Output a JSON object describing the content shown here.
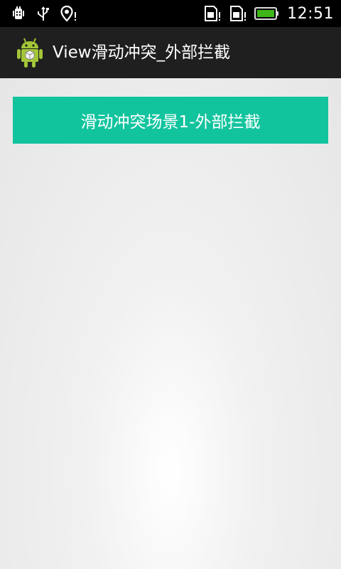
{
  "status_bar": {
    "time": "12:51",
    "left_icons": [
      "debug-icon",
      "usb-icon",
      "location-alert-icon"
    ],
    "right_icons": [
      "sd-card-alert-icon",
      "sd-card-alert-icon",
      "battery-icon"
    ],
    "battery_color": "#3fb618"
  },
  "action_bar": {
    "title": "View滑动冲突_外部拦截",
    "icon": "android-app-icon",
    "background": "#1f1f1f"
  },
  "main": {
    "button_label": "滑动冲突场景1-外部拦截",
    "button_color": "#12c49e"
  }
}
